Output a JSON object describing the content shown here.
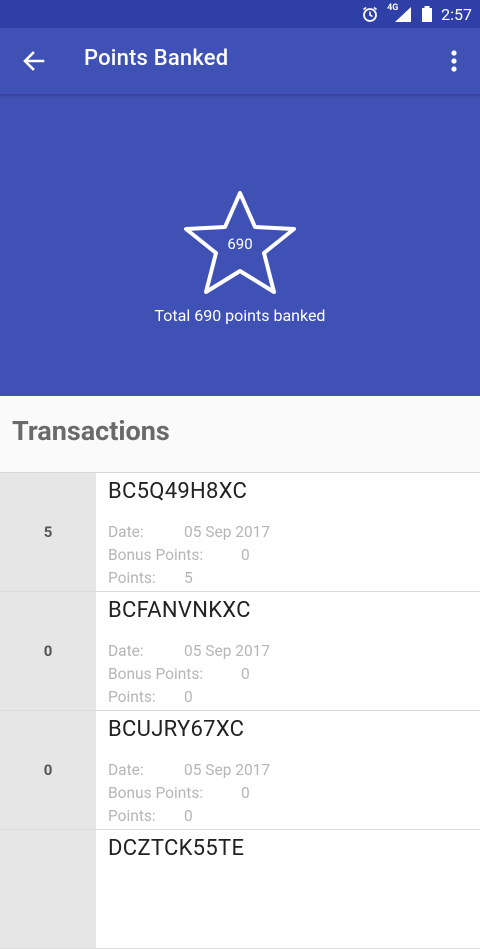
{
  "status_bar": {
    "time": "2:57",
    "network_label": "4G",
    "icons": [
      "alarm-icon",
      "signal-icon",
      "battery-icon"
    ]
  },
  "toolbar": {
    "title": "Points Banked",
    "icons": [
      "back-arrow-icon",
      "more-vert-icon"
    ]
  },
  "summary": {
    "star_value": "690",
    "total_text": "Total 690 points banked"
  },
  "transactions": {
    "title": "Transactions",
    "labels": {
      "date": "Date:",
      "bonus": "Bonus Points:",
      "points": "Points:"
    },
    "items": [
      {
        "points": "5",
        "code": "BC5Q49H8XC",
        "date": "05 Sep 2017",
        "bonus": "0",
        "points_value": "5"
      },
      {
        "points": "0",
        "code": "BCFANVNKXC",
        "date": "05 Sep 2017",
        "bonus": "0",
        "points_value": "0"
      },
      {
        "points": "0",
        "code": "BCUJRY67XC",
        "date": "05 Sep 2017",
        "bonus": "0",
        "points_value": "0"
      },
      {
        "points": "",
        "code": "DCZTCK55TE",
        "date": "",
        "bonus": "",
        "points_value": ""
      }
    ]
  },
  "colors": {
    "primary": "#3f51b5",
    "primary_dark": "#2f3fa8",
    "background": "#fafafa",
    "row_left": "#e6e6e6"
  }
}
